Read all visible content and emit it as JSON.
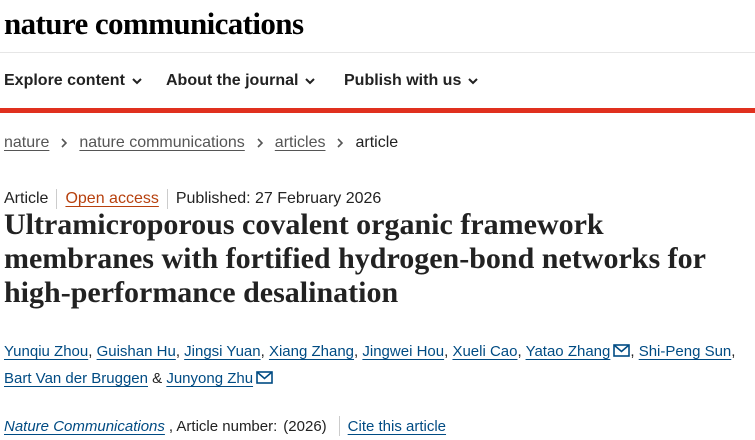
{
  "brand": "nature communications",
  "nav": [
    {
      "label": "Explore content",
      "icon": "chevron-down-icon"
    },
    {
      "label": "About the journal",
      "icon": "chevron-down-icon"
    },
    {
      "label": "Publish with us",
      "icon": "chevron-down-icon"
    }
  ],
  "colors": {
    "accent_bar": "#e0301e",
    "link": "#004b83",
    "open_access": "#b7410e"
  },
  "breadcrumb": [
    "nature",
    "nature communications",
    "articles",
    "article"
  ],
  "article": {
    "type": "Article",
    "access": "Open access",
    "published": "Published: 27 February 2026",
    "title": "Ultramicroporous covalent organic framework membranes with fortified hydrogen-bond networks for high-performance desalination",
    "authors": {
      "a1": "Yunqiu Zhou",
      "a2": "Guishan Hu",
      "a3": "Jingsi Yuan",
      "a4": "Xiang Zhang",
      "a5": "Jingwei Hou",
      "a6": "Xueli Cao",
      "a7": "Yatao Zhang",
      "a8": "Shi-Peng Sun",
      "a9": "Bart Van der Bruggen",
      "a10": "Junyong Zhu"
    },
    "journal": "Nature Communications",
    "article_number_label": ", Article number:",
    "year": "(2026)",
    "cite": "Cite this article"
  }
}
